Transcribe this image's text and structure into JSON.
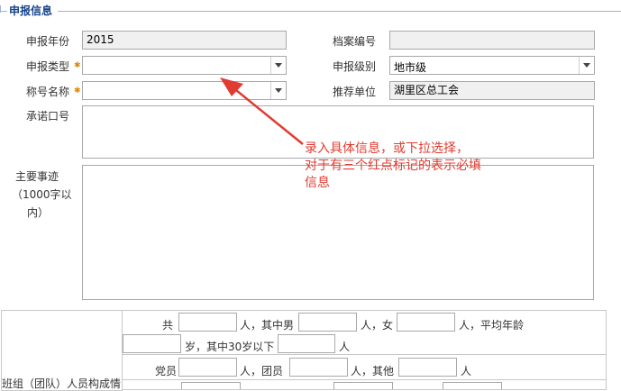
{
  "section": {
    "title": "申报信息"
  },
  "fields": {
    "year": {
      "label": "申报年份",
      "value": "2015"
    },
    "archive_no": {
      "label": "档案编号",
      "value": ""
    },
    "type": {
      "label": "申报类型",
      "value": ""
    },
    "level": {
      "label": "申报级别",
      "value": "地市级"
    },
    "honor": {
      "label": "称号名称",
      "value": ""
    },
    "recommender": {
      "label": "推荐单位",
      "value": "湖里区总工会"
    },
    "slogan": {
      "label": "承诺口号",
      "value": ""
    },
    "deeds": {
      "label_line1": "主要事迹",
      "label_line2": "（1000字以",
      "label_line3": "内）",
      "value": ""
    }
  },
  "annotation": {
    "line1": "录入具体信息，或下拉选择，",
    "line2": "对于有三个红点标记的表示必填",
    "line3": "信息"
  },
  "group": {
    "row_label": "班组（团队）人员构成情",
    "total_prefix": "共",
    "unit": "人",
    "male_text": "人，其中男",
    "female_text": "人，女",
    "avg_age_text": "人，平均年龄",
    "under30_text": "岁，其中30岁以下",
    "party_label": "党员",
    "league_text": "人，团员",
    "other_text": "人，其他"
  },
  "colors": {
    "legend": "#15428b",
    "required_marker": "#e08a00",
    "annotation": "#e03c31"
  }
}
